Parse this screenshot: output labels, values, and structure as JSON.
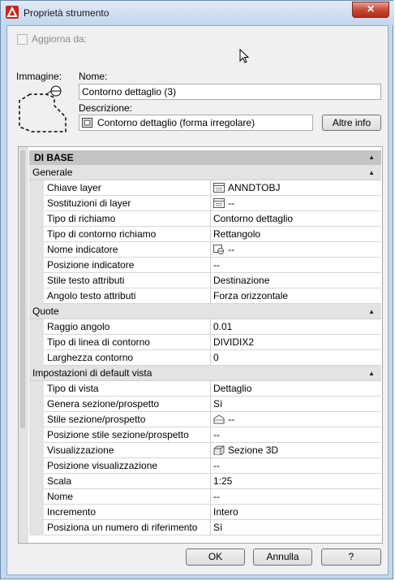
{
  "window": {
    "title": "Proprietà strumento",
    "close_glyph": "✕"
  },
  "update_from": {
    "label": "Aggiorna da:",
    "checked": false
  },
  "image_label": "Immagine:",
  "name": {
    "label": "Nome:",
    "value": "Contorno dettaglio (3)"
  },
  "description": {
    "label": "Descrizione:",
    "value": "Contorno dettaglio (forma irregolare)"
  },
  "more_info_button": "Altre info",
  "grid": {
    "top_category": "DI BASE",
    "sections": [
      {
        "title": "Generale",
        "rows": [
          {
            "key": "Chiave layer",
            "value": "ANNDTOBJ",
            "icon": "layer-key-icon"
          },
          {
            "key": "Sostituzioni di layer",
            "value": "--",
            "icon": "layer-overrides-icon"
          },
          {
            "key": "Tipo di richiamo",
            "value": "Contorno dettaglio"
          },
          {
            "key": "Tipo di contorno richiamo",
            "value": "Rettangolo"
          },
          {
            "key": "Nome indicatore",
            "value": "--",
            "icon": "marker-name-icon"
          },
          {
            "key": "Posizione indicatore",
            "value": "--"
          },
          {
            "key": "Stile testo attributi",
            "value": "Destinazione"
          },
          {
            "key": "Angolo testo attributi",
            "value": "Forza orizzontale"
          }
        ]
      },
      {
        "title": "Quote",
        "rows": [
          {
            "key": "Raggio angolo",
            "value": "0.01"
          },
          {
            "key": "Tipo di linea di contorno",
            "value": "DIVIDIX2"
          },
          {
            "key": "Larghezza contorno",
            "value": "0"
          }
        ]
      },
      {
        "title": "Impostazioni di default vista",
        "rows": [
          {
            "key": "Tipo di vista",
            "value": "Dettaglio"
          },
          {
            "key": "Genera sezione/prospetto",
            "value": "Sì"
          },
          {
            "key": "Stile sezione/prospetto",
            "value": "--",
            "icon": "section-style-icon"
          },
          {
            "key": "Posizione stile sezione/prospetto",
            "value": "--"
          },
          {
            "key": "Visualizzazione",
            "value": "Sezione 3D",
            "icon": "3d-section-icon"
          },
          {
            "key": "Posizione visualizzazione",
            "value": "--"
          },
          {
            "key": "Scala",
            "value": "1:25"
          },
          {
            "key": "Nome",
            "value": "--"
          },
          {
            "key": "Incremento",
            "value": "Intero"
          },
          {
            "key": "Posiziona un numero di riferimento",
            "value": "Sì"
          }
        ]
      }
    ]
  },
  "buttons": {
    "ok": "OK",
    "cancel": "Annulla",
    "help": "?"
  }
}
